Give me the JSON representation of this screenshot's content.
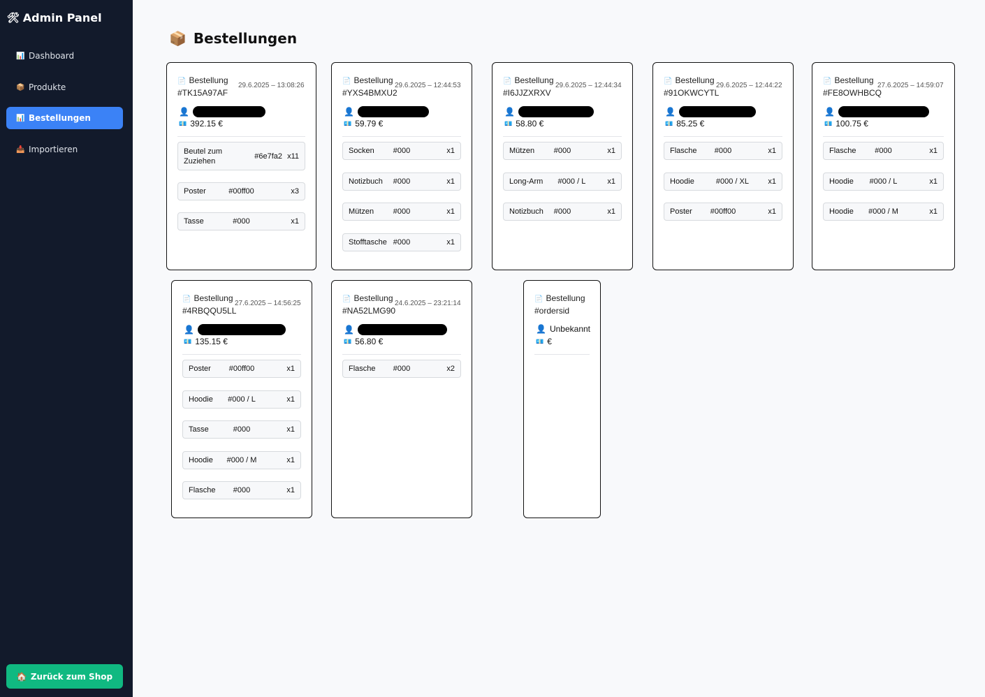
{
  "sidebar": {
    "brand": "Admin Panel",
    "brand_icon": "tools-icon",
    "items": [
      {
        "label": "Dashboard",
        "icon": "chart-icon",
        "active": false
      },
      {
        "label": "Produkte",
        "icon": "package-icon",
        "active": false
      },
      {
        "label": "Bestellungen",
        "icon": "chart-icon",
        "active": true
      },
      {
        "label": "Importieren",
        "icon": "inbox-icon",
        "active": false
      }
    ],
    "back_button": "Zurück zum Shop"
  },
  "colors": {
    "sidebar_bg": "#121a2b",
    "active": "#3b82f6",
    "back_button": "#10b981"
  },
  "main": {
    "title": "Bestellungen",
    "orders": [
      {
        "label": "Bestellung",
        "id": "#TK15A97AF",
        "date": "29.6.2025 – 13:08:26",
        "total": "392.15 €",
        "items": [
          {
            "name": "Beutel zum Zuziehen",
            "color": "#6e7fa2",
            "qty": "x11"
          },
          {
            "name": "Poster",
            "color": "#00ff00",
            "qty": "x3"
          },
          {
            "name": "Tasse",
            "color": "#000",
            "qty": "x1"
          }
        ]
      },
      {
        "label": "Bestellung",
        "id": "#YXS4BMXU2",
        "date": "29.6.2025 – 12:44:53",
        "total": "59.79 €",
        "items": [
          {
            "name": "Socken",
            "color": "#000",
            "qty": "x1"
          },
          {
            "name": "Notizbuch",
            "color": "#000",
            "qty": "x1"
          },
          {
            "name": "Mützen",
            "color": "#000",
            "qty": "x1"
          },
          {
            "name": "Stofftasche",
            "color": "#000",
            "qty": "x1"
          }
        ]
      },
      {
        "label": "Bestellung",
        "id": "#I6JJZXRXV",
        "date": "29.6.2025 – 12:44:34",
        "total": "58.80 €",
        "items": [
          {
            "name": "Mützen",
            "color": "#000",
            "qty": "x1"
          },
          {
            "name": "Long-Arm",
            "color": "#000 / L",
            "qty": "x1"
          },
          {
            "name": "Notizbuch",
            "color": "#000",
            "qty": "x1"
          }
        ]
      },
      {
        "label": "Bestellung",
        "id": "#91OKWCYTL",
        "date": "29.6.2025 – 12:44:22",
        "total": "85.25 €",
        "items": [
          {
            "name": "Flasche",
            "color": "#000",
            "qty": "x1"
          },
          {
            "name": "Hoodie",
            "color": "#000 / XL",
            "qty": "x1"
          },
          {
            "name": "Poster",
            "color": "#00ff00",
            "qty": "x1"
          }
        ]
      },
      {
        "label": "Bestellung",
        "id": "#FE8OWHBCQ",
        "date": "27.6.2025 – 14:59:07",
        "total": "100.75 €",
        "items": [
          {
            "name": "Flasche",
            "color": "#000",
            "qty": "x1"
          },
          {
            "name": "Hoodie",
            "color": "#000 / L",
            "qty": "x1"
          },
          {
            "name": "Hoodie",
            "color": "#000 / M",
            "qty": "x1"
          }
        ]
      },
      {
        "label": "Bestellung",
        "id": "#4RBQQU5LL",
        "date": "27.6.2025 – 14:56:25",
        "total": "135.15 €",
        "items": [
          {
            "name": "Poster",
            "color": "#00ff00",
            "qty": "x1"
          },
          {
            "name": "Hoodie",
            "color": "#000 / L",
            "qty": "x1"
          },
          {
            "name": "Tasse",
            "color": "#000",
            "qty": "x1"
          },
          {
            "name": "Hoodie",
            "color": "#000 / M",
            "qty": "x1"
          },
          {
            "name": "Flasche",
            "color": "#000",
            "qty": "x1"
          }
        ]
      },
      {
        "label": "Bestellung",
        "id": "#NA52LMG90",
        "date": "24.6.2025 – 23:21:14",
        "total": "56.80 €",
        "items": [
          {
            "name": "Flasche",
            "color": "#000",
            "qty": "x2"
          }
        ]
      },
      {
        "label": "Bestellung",
        "id": "#ordersid",
        "date": "",
        "customer": "Unbekannt",
        "total": "€",
        "items": []
      }
    ]
  }
}
